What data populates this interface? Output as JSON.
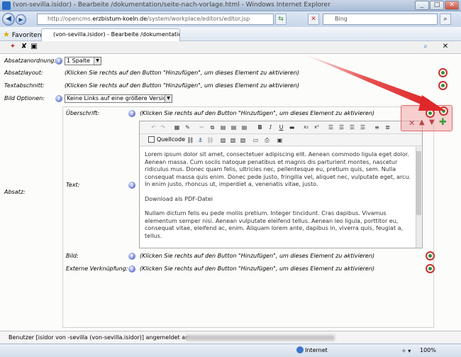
{
  "window": {
    "title": "(von-sevilla.isidor) - Bearbeite /dokumentation/seite-nach-vorlage.html - Windows Internet Explorer",
    "min": "_",
    "max": "□",
    "close": "✕"
  },
  "address": {
    "prefix": "http://opencms.",
    "domain": "erzbistum-koeln.de",
    "path": "/system/workplace/editors/editor.jsp",
    "search_placeholder": "Bing"
  },
  "favorites": {
    "label": "Favoriten",
    "tab_title": "(von-sevilla.isidor) - Bearbeite /dokumentation/seite-n..."
  },
  "form": {
    "absatzanordnung_label": "Absatzanordnung:",
    "absatzanordnung_value": "1 Spalte",
    "absatzlayout_label": "Absatzlayout:",
    "textabschnitt_label": "Textabschnitt:",
    "bild_optionen_label": "Bild Optionen:",
    "bild_optionen_value": "Keine Links auf eine größere Version",
    "absatz_label": "Absatz:",
    "ueberschrift_label": "Überschrift:",
    "text_label": "Text:",
    "bild_label": "Bild:",
    "externe_label": "Externe Verknüpfung:",
    "hint": "(Klicken Sie rechts auf den Button \"Hinzufügen\", um dieses Element zu aktivieren)",
    "help": "?"
  },
  "editor": {
    "quellcode": "Quellcode",
    "paragraph1": "Lorem ipsum dolor sit amet, consectetuer adipiscing elit. Aenean commodo ligula eget dolor. Aenean massa. Cum sociis natoque penatibus et magnis dis parturient montes, nascetur ridiculus mus. Donec quam felis, ultricies nec, pellentesque eu, pretium quis, sem. Nulla consequat massa quis enim. Donec pede justo, fringilla vel, aliquet nec, vulputate eget, arcu. In enim justo, rhoncus ut, imperdiet a, venenatis vitae, justo.",
    "paragraph2": "Download als PDF-Datei",
    "paragraph3": "Nullam dictum felis eu pede mollis pretium. Integer tincidunt. Cras dapibus. Vivamus elementum semper nisi. Aenean vulputate eleifend tellus. Aenean leo ligula, porttitor eu, consequat vitae, eleifend ac, enim. Aliquam lorem ante, dapibus in, viverra quis, feugiat a, tellus."
  },
  "status": {
    "user": "Benutzer [isidor von -sevilla (von-sevilla.isidor)] angemeldet am",
    "zone": "Internet",
    "zoom": "100%"
  },
  "colors": {
    "highlight_arrow": "#e0282a",
    "add_button_ring": "#c9302c",
    "help_icon": "#3b4fc4"
  }
}
